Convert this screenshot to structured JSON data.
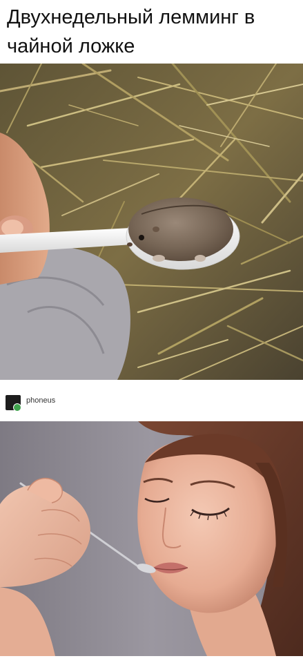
{
  "caption": {
    "text": "Двухнедельный лемминг в чайной ложке"
  },
  "post": {
    "username": "phoneus"
  },
  "images": {
    "top": "lemming-in-teaspoon-photo",
    "bottom": "woman-eating-from-spoon-photo"
  },
  "colors": {
    "hay": "#8a7a4a",
    "fur": "#7a6a5a",
    "skin": "#e8b8a0",
    "hair": "#6a3a2a",
    "background_gray": "#8f8a92"
  }
}
